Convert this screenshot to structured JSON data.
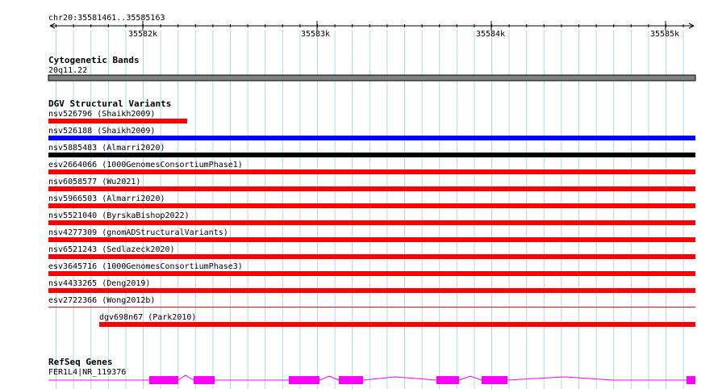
{
  "ruler": {
    "location": "chr20:35581461..35585163",
    "ticks": [
      "35582k",
      "35583k",
      "35584k",
      "35585k"
    ]
  },
  "tracks": {
    "cytoband": {
      "title": "Cytogenetic Bands",
      "band": "20q11.22",
      "color": "#808080"
    },
    "dgv": {
      "title": "DGV Structural Variants",
      "colors": {
        "loss": "#ff0000",
        "gain": "#0000ff",
        "complex": "#000000"
      },
      "items": [
        {
          "label": "nsv526796 (Shaikh2009)",
          "type": "loss"
        },
        {
          "label": "nsv526188 (Shaikh2009)",
          "type": "gain"
        },
        {
          "label": "nsv5885483 (Almarri2020)",
          "type": "complex"
        },
        {
          "label": "esv2664066 (1000GenomesConsortiumPhase1)",
          "type": "loss"
        },
        {
          "label": "nsv6058577 (Wu2021)",
          "type": "loss"
        },
        {
          "label": "nsv5966503 (Almarri2020)",
          "type": "loss"
        },
        {
          "label": "nsv5521040 (ByrskaBishop2022)",
          "type": "loss"
        },
        {
          "label": "nsv4277309 (gnomADStructuralVariants)",
          "type": "loss"
        },
        {
          "label": "nsv6521243 (Sedlazeck2020)",
          "type": "loss"
        },
        {
          "label": "esv3645716 (1000GenomesConsortiumPhase3)",
          "type": "loss"
        },
        {
          "label": "nsv4433265 (Deng2019)",
          "type": "loss"
        },
        {
          "label": "esv2722366 (Wong2012b)",
          "type": "loss"
        },
        {
          "label": "dgv698n67 (Park2010)",
          "type": "loss"
        }
      ]
    },
    "refseq": {
      "title": "RefSeq Genes",
      "gene": "FER1L4|NR_119376",
      "color": "#ff00ff"
    }
  }
}
